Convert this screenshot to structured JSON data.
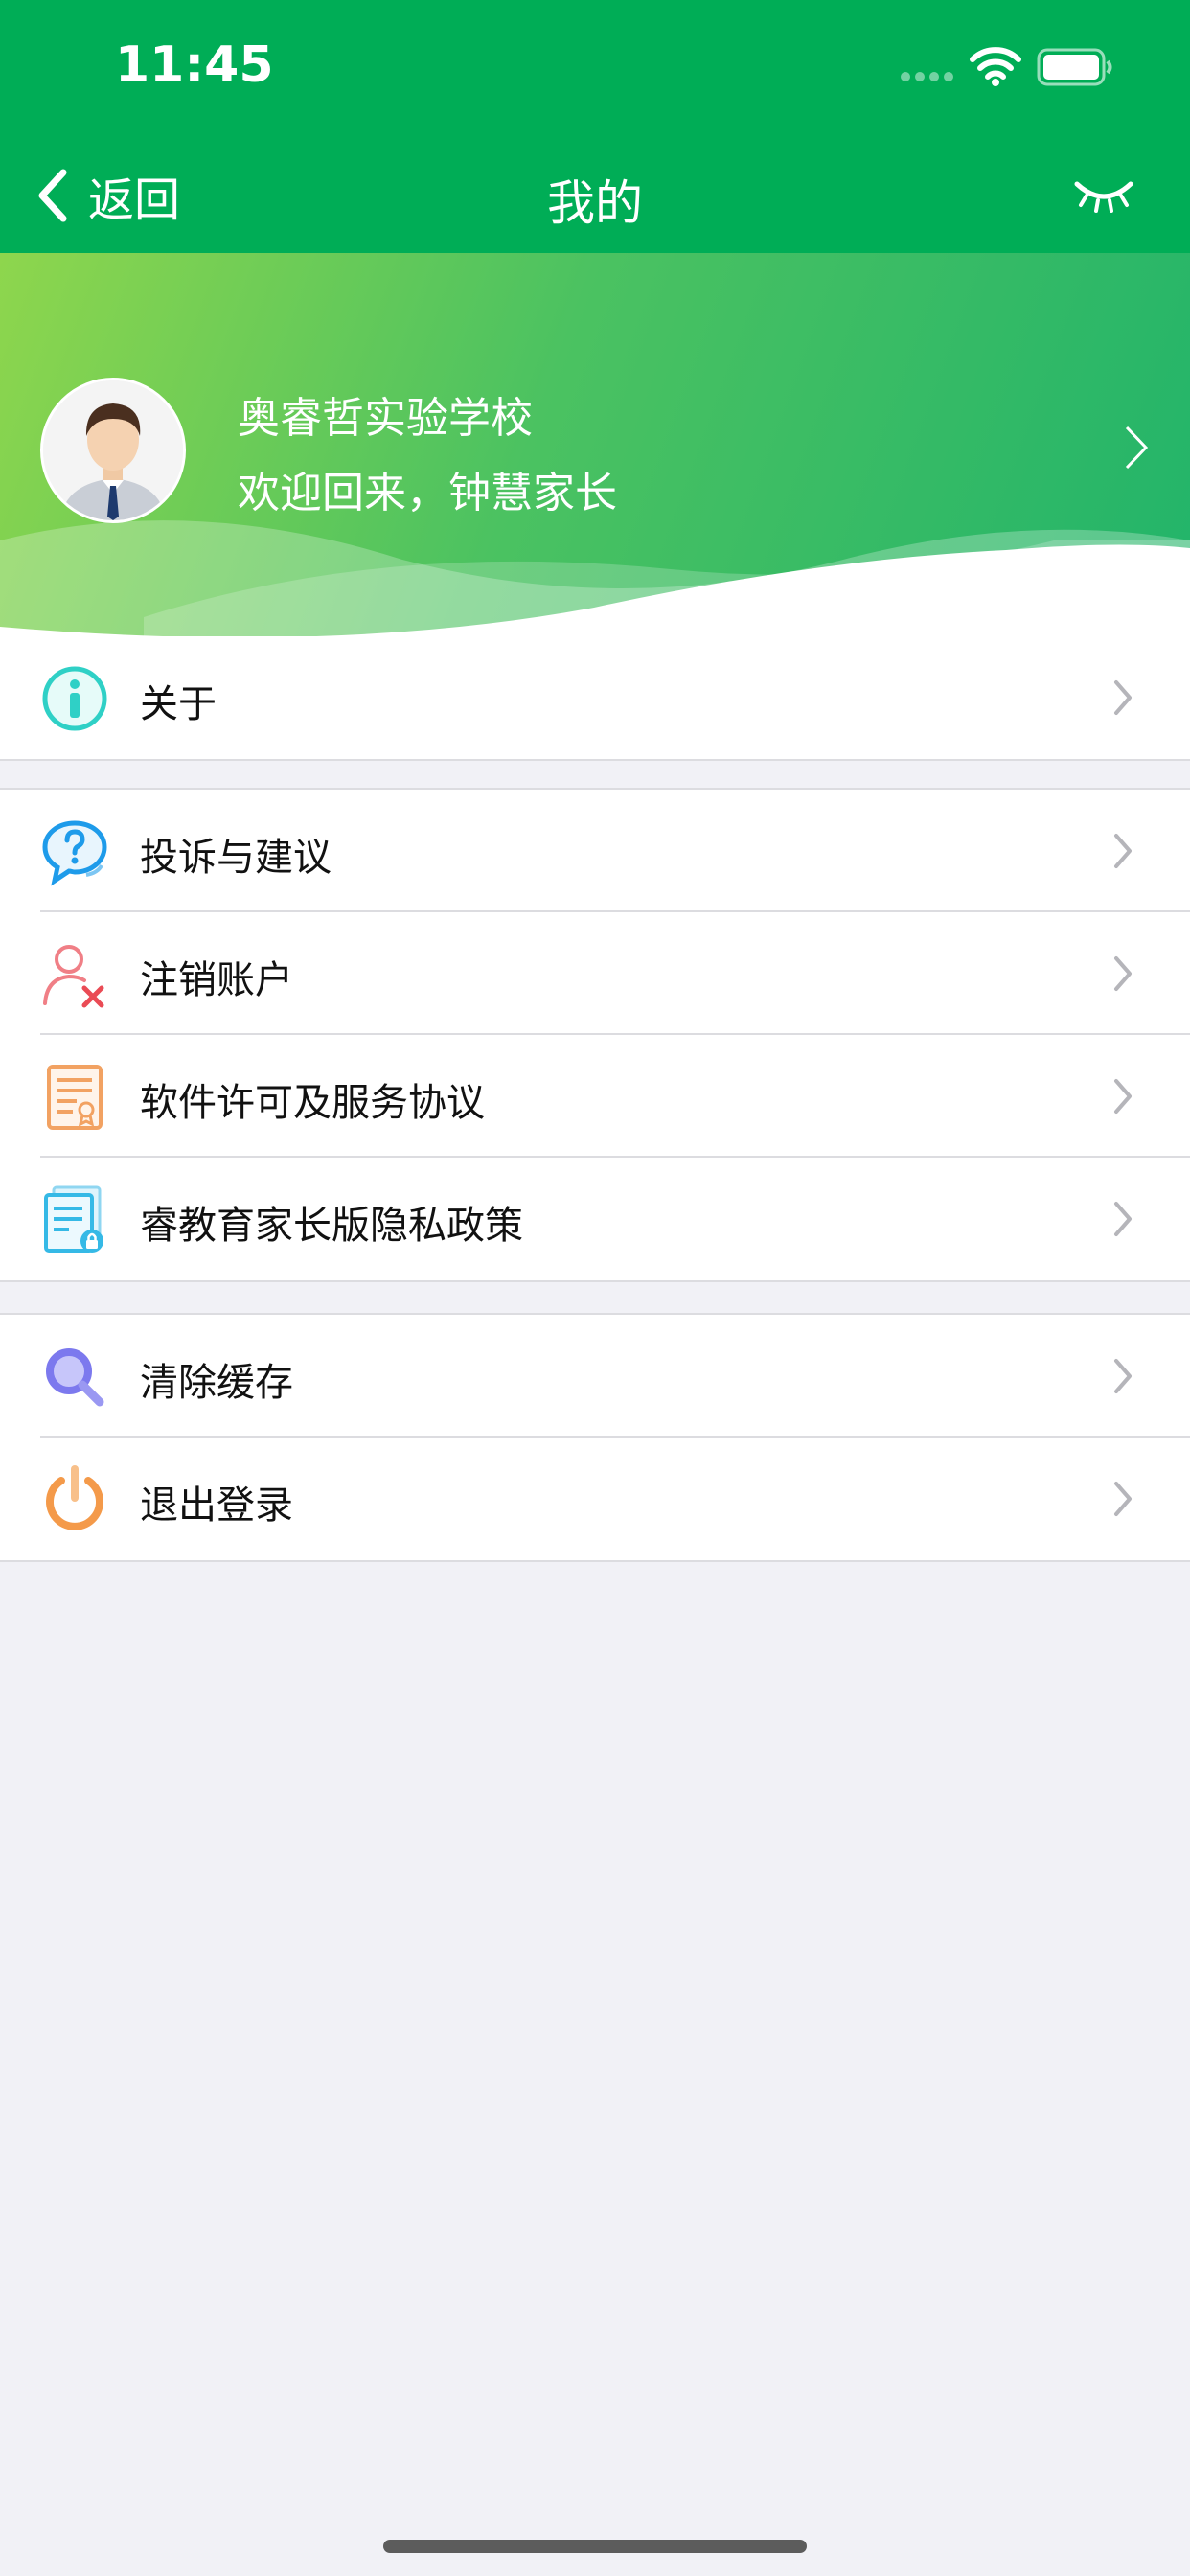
{
  "status_bar": {
    "time": "11:45"
  },
  "nav": {
    "back_label": "返回",
    "title": "我的"
  },
  "profile": {
    "school_name": "奥睿哲实验学校",
    "welcome": "欢迎回来，钟慧家长"
  },
  "menu": {
    "about": "关于",
    "feedback": "投诉与建议",
    "cancel_account": "注销账户",
    "license": "软件许可及服务协议",
    "privacy": "睿教育家长版隐私政策",
    "clear_cache": "清除缓存",
    "logout": "退出登录"
  },
  "colors": {
    "brand_green": "#00ad56",
    "about_icon": "#2fd0c6",
    "feedback_icon": "#1e9bea",
    "cancel_icon": "#f07f86",
    "license_icon": "#f2a262",
    "privacy_icon": "#35b9e6",
    "cache_icon": "#7c79ee",
    "logout_icon": "#f49a4a"
  },
  "icons": [
    "back-chevron-icon",
    "eye-closed-icon",
    "wifi-icon",
    "battery-icon",
    "info-icon",
    "question-chat-icon",
    "user-remove-icon",
    "certificate-document-icon",
    "privacy-lock-document-icon",
    "search-magnifier-icon",
    "power-icon",
    "chevron-right-icon"
  ]
}
